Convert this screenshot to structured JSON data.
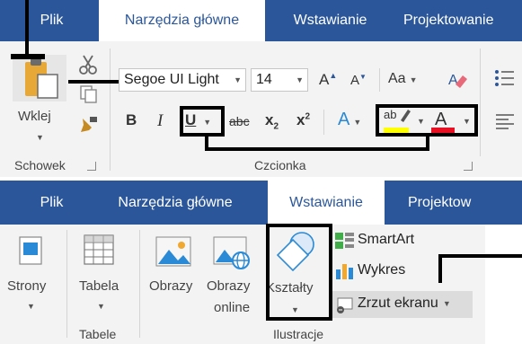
{
  "top": {
    "tabs": [
      {
        "label": "Plik",
        "active": false
      },
      {
        "label": "Narzędzia główne",
        "active": true
      },
      {
        "label": "Wstawianie",
        "active": false
      },
      {
        "label": "Projektowanie",
        "active": false
      }
    ],
    "clipboard": {
      "paste_label": "Wklej",
      "group_label": "Schowek"
    },
    "font": {
      "font_name": "Segoe UI Light",
      "font_size": "14",
      "change_case": "Aa",
      "bold": "B",
      "italic": "I",
      "underline": "U",
      "strikethrough": "abc",
      "subscript": "x",
      "subscript_mark": "2",
      "superscript": "x",
      "superscript_mark": "2",
      "text_effects": "A",
      "highlight_text": "ab",
      "font_color": "A",
      "grow": "A",
      "shrink": "A",
      "group_label": "Czcionka"
    },
    "colors": {
      "highlight": "#ffff00",
      "font_color": "#e81123"
    }
  },
  "bottom": {
    "tabs": [
      {
        "label": "Plik",
        "active": false
      },
      {
        "label": "Narzędzia główne",
        "active": false
      },
      {
        "label": "Wstawianie",
        "active": true
      },
      {
        "label": "Projektow",
        "active": false
      }
    ],
    "pages": {
      "label": "Strony"
    },
    "tables": {
      "table_label": "Tabela",
      "group_label": "Tabele"
    },
    "illustrations": {
      "pictures_label": "Obrazy",
      "online_line1": "Obrazy",
      "online_line2": "online",
      "shapes_label": "Kształty",
      "smartart_label": "SmartArt",
      "chart_label": "Wykres",
      "screenshot_label": "Zrzut ekranu",
      "group_label": "Ilustracje"
    }
  },
  "theme": {
    "tab_blue": "#2b579a",
    "ribbon_bg": "#f3f3f3"
  }
}
